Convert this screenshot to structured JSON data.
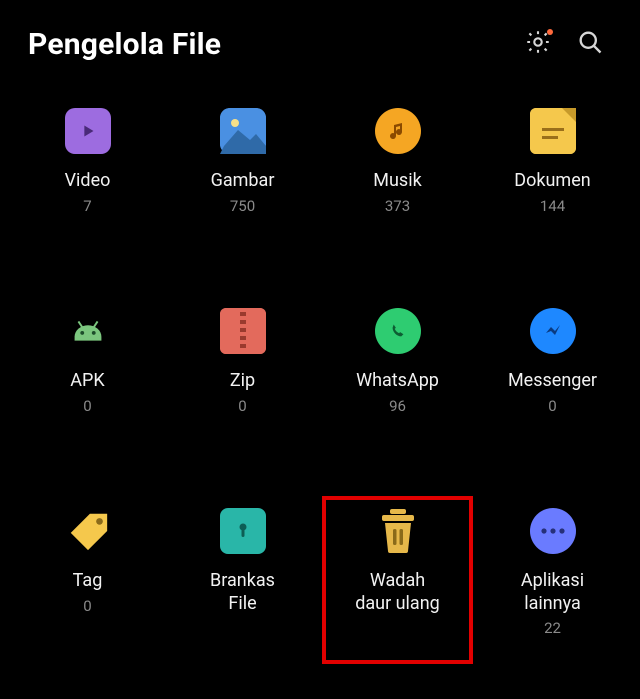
{
  "header": {
    "title": "Pengelola File"
  },
  "categories": [
    {
      "label": "Video",
      "count": "7",
      "icon": "play-icon"
    },
    {
      "label": "Gambar",
      "count": "750",
      "icon": "image-icon"
    },
    {
      "label": "Musik",
      "count": "373",
      "icon": "music-icon"
    },
    {
      "label": "Dokumen",
      "count": "144",
      "icon": "document-icon"
    },
    {
      "label": "APK",
      "count": "0",
      "icon": "android-icon"
    },
    {
      "label": "Zip",
      "count": "0",
      "icon": "zip-icon"
    },
    {
      "label": "WhatsApp",
      "count": "96",
      "icon": "whatsapp-icon"
    },
    {
      "label": "Messenger",
      "count": "0",
      "icon": "messenger-icon"
    },
    {
      "label": "Tag",
      "count": "0",
      "icon": "tag-icon"
    },
    {
      "label": "Brankas\nFile",
      "count": "",
      "icon": "vault-icon"
    },
    {
      "label": "Wadah\ndaur ulang",
      "count": "",
      "icon": "trash-icon"
    },
    {
      "label": "Aplikasi\nlainnya",
      "count": "22",
      "icon": "more-icon"
    }
  ]
}
